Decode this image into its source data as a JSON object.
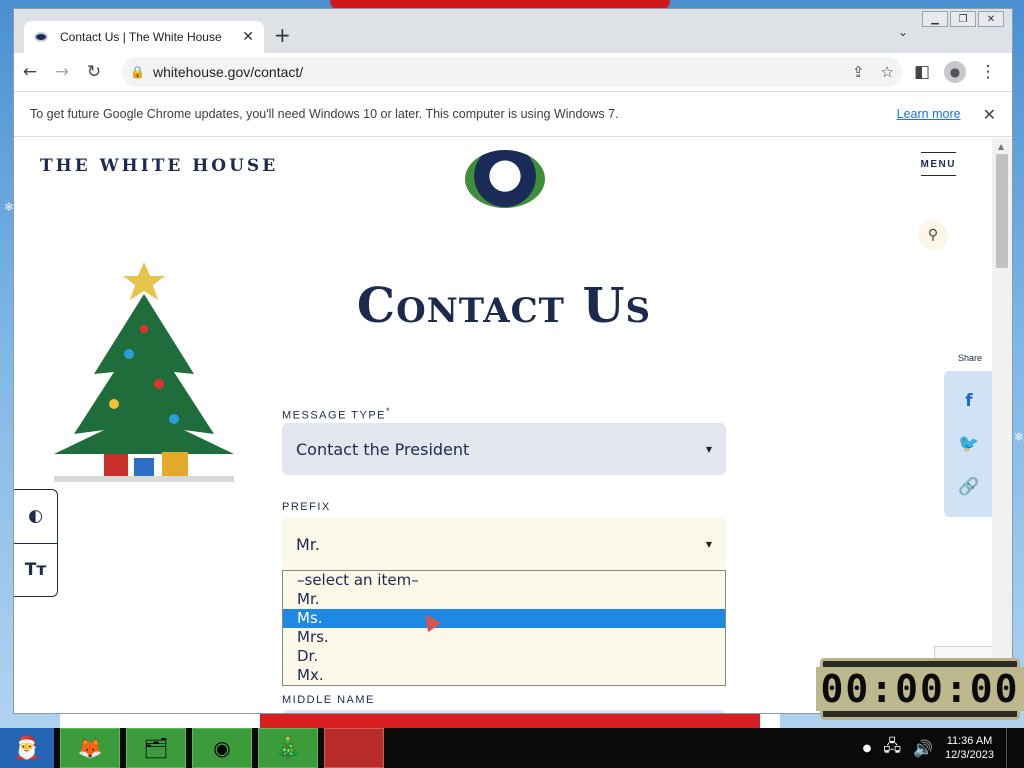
{
  "browser": {
    "tab_title": "Contact Us | The White House",
    "new_tab": "+",
    "url": "whitehouse.gov/contact/",
    "infobar_message": "To get future Google Chrome updates, you'll need Windows 10 or later. This computer is using Windows 7.",
    "infobar_link": "Learn more"
  },
  "site": {
    "brand": "THE WHITE HOUSE",
    "menu": "MENU",
    "page_title": "Contact Us",
    "share_label": "Share"
  },
  "form": {
    "message_type_label": "MESSAGE TYPE",
    "message_type_required": "*",
    "message_type_value": "Contact the President",
    "prefix_label": "PREFIX",
    "prefix_value": "Mr.",
    "prefix_options": [
      "–select an item–",
      "Mr.",
      "Ms.",
      "Mrs.",
      "Dr.",
      "Mx."
    ],
    "highlighted_option": "Ms.",
    "middle_name_label": "MIDDLE NAME"
  },
  "overlay": {
    "timer": "00:00:00"
  },
  "taskbar": {
    "time": "11:36 AM",
    "date": "12/3/2023"
  }
}
